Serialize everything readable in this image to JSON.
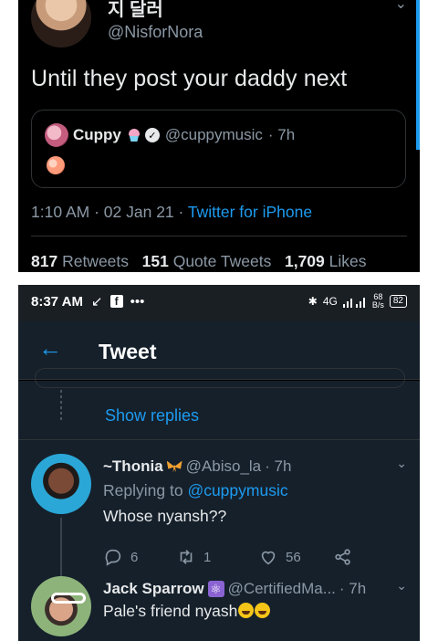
{
  "top": {
    "author_name": "지 달러",
    "author_handle": "@NisforNora",
    "chevron": "⌄",
    "text": "Until they post your daddy next",
    "quote": {
      "name": "Cuppy",
      "handle": "@cuppymusic",
      "time": "· 7h",
      "verified_glyph": "✓"
    },
    "meta": {
      "time": "1:10 AM",
      "date": "· 02 Jan 21 ·",
      "client": "Twitter for iPhone"
    },
    "stats": {
      "retweets_count": "817",
      "retweets_label": "Retweets",
      "quote_count": "151",
      "quote_label": "Quote Tweets",
      "likes_count": "1,709",
      "likes_label": "Likes"
    }
  },
  "status_bar": {
    "time": "8:37 AM",
    "left_icons": [
      "missed-call-icon",
      "facebook-icon",
      "more-dots-icon"
    ],
    "missed_glyph": "↙",
    "fb_glyph": "f",
    "dots": "•••",
    "bluetooth": "✱",
    "network": "4G",
    "speed_top": "68",
    "speed_bottom": "B/s",
    "battery": "82"
  },
  "app_bar": {
    "back_glyph": "←",
    "title": "Tweet"
  },
  "thread": {
    "show_replies": "Show replies",
    "replies": [
      {
        "name": "~Thonia",
        "handle": "@Abiso_la",
        "time": "· 7h",
        "replying_prefix": "Replying to",
        "replying_to": "@cuppymusic",
        "text": "Whose nyansh??",
        "reply_count": "6",
        "retweet_count": "1",
        "like_count": "56"
      },
      {
        "name": "Jack Sparrow",
        "handle": "@CertifiedMa...",
        "time": "· 7h",
        "badge_glyph": "⚛",
        "text": "Pale's friend nyash"
      }
    ]
  },
  "colors": {
    "accent": "#1d9bf0",
    "background_top": "#000000",
    "background_bottom": "#15202b",
    "muted": "#8b98a5",
    "text": "#e7e9ea"
  }
}
